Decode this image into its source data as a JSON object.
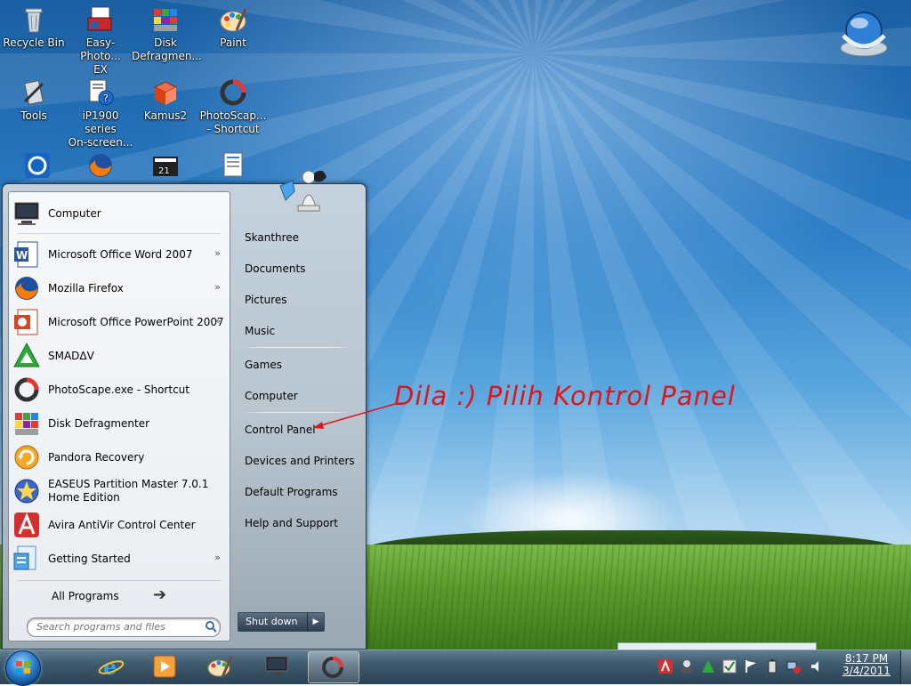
{
  "desktop": {
    "icons": [
      {
        "label": "Recycle Bin",
        "name": "recycle-bin-icon"
      },
      {
        "label": "Easy-Photo...\nEX",
        "name": "easy-photo-icon"
      },
      {
        "label": "Disk\nDefragmen...",
        "name": "disk-defragmenter-icon"
      },
      {
        "label": "Paint",
        "name": "paint-icon"
      },
      {
        "label": "Tools",
        "name": "tools-icon"
      },
      {
        "label": "iP1900 series\nOn-screen...",
        "name": "ip1900-manual-icon"
      },
      {
        "label": "Kamus2",
        "name": "kamus2-icon"
      },
      {
        "label": "PhotoScap...\n- Shortcut",
        "name": "photoscape-icon"
      }
    ]
  },
  "start_menu": {
    "left_items": [
      {
        "label": "Computer",
        "arrow": ""
      },
      {
        "label": "Microsoft Office Word 2007",
        "arrow": "»"
      },
      {
        "label": "Mozilla Firefox",
        "arrow": "»"
      },
      {
        "label": "Microsoft Office PowerPoint 2007",
        "arrow": "»"
      },
      {
        "label": "SMADΔV",
        "arrow": ""
      },
      {
        "label": "PhotoScape.exe - Shortcut",
        "arrow": ""
      },
      {
        "label": "Disk Defragmenter",
        "arrow": ""
      },
      {
        "label": "Pandora Recovery",
        "arrow": ""
      },
      {
        "label": "EASEUS Partition Master 7.0.1\nHome Edition",
        "arrow": ""
      },
      {
        "label": "Avira AntiVir Control Center",
        "arrow": ""
      },
      {
        "label": "Getting Started",
        "arrow": "»"
      }
    ],
    "all_programs": "All Programs",
    "search_placeholder": "Search programs and files",
    "right_items": [
      "Skanthree",
      "Documents",
      "Pictures",
      "Music",
      "Games",
      "Computer",
      "Control Panel",
      "Devices and Printers",
      "Default Programs",
      "Help and Support"
    ],
    "shutdown_label": "Shut down",
    "shutdown_arrow": "▶"
  },
  "annotation": "Dila :) Pilih Kontrol Panel",
  "taskbar": {
    "clock_time": "8:17 PM",
    "clock_date": "3/4/2011"
  },
  "colors": {
    "annotation": "#e1141c",
    "taskbar": "#3f5a6d"
  }
}
